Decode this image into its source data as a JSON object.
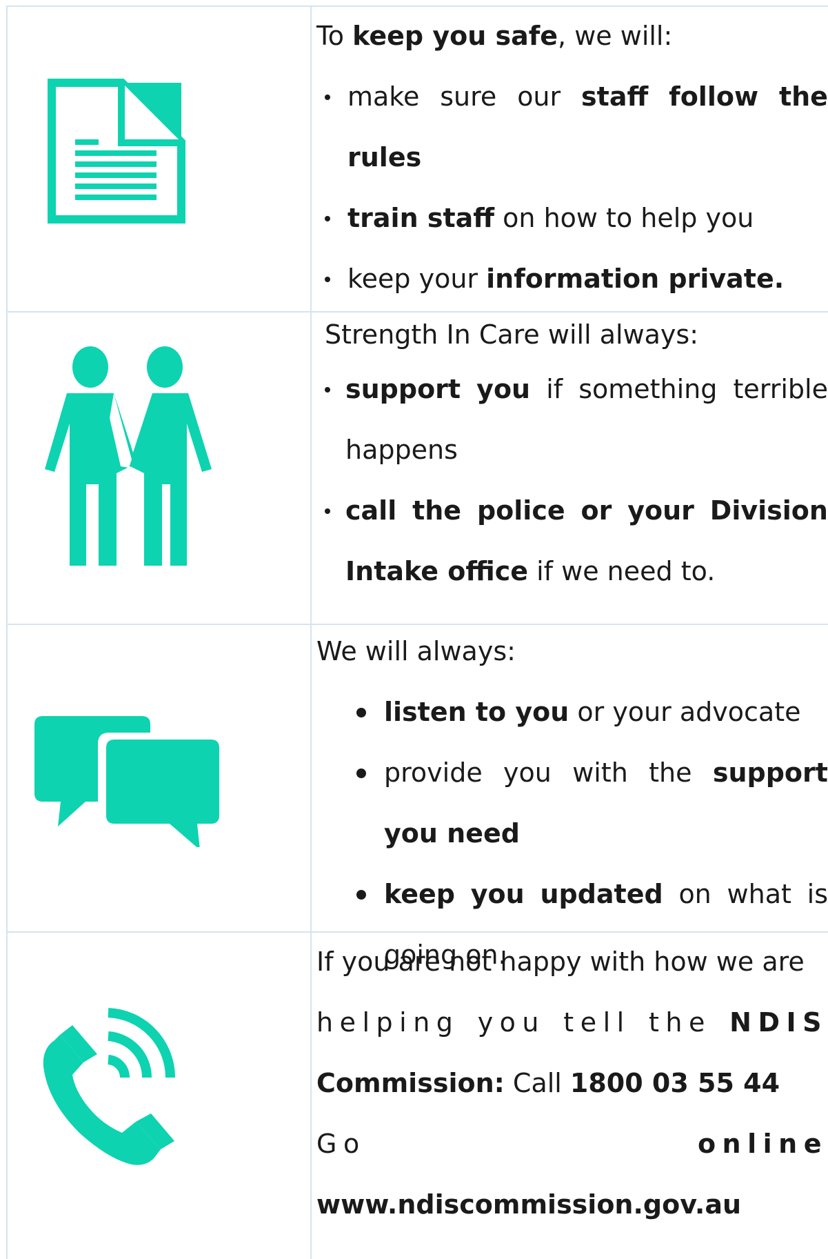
{
  "colors": {
    "accent": "#0dd3b0",
    "border": "#d6e4ef",
    "text": "#1a1a1a"
  },
  "rows": [
    {
      "icon": "document-icon",
      "intro": {
        "a": "To ",
        "b": "keep you safe",
        "c": ", we will:"
      },
      "bullets": [
        {
          "l1": [
            "make",
            "sure",
            "our"
          ],
          "l1b": [
            "staff",
            "follow",
            "the"
          ],
          "l2b": "rules"
        },
        {
          "b": "train staff",
          "t": " on how to help you"
        },
        {
          "t": "keep your ",
          "b": "information private."
        }
      ]
    },
    {
      "icon": "two-people-icon",
      "intro": "Strength In Care will always:",
      "bullets": [
        {
          "l1b": [
            "support",
            "you"
          ],
          "l1": [
            "if",
            "something",
            "terrible"
          ],
          "l2": "happens"
        },
        {
          "l1b": [
            "call",
            "the",
            "police",
            "or",
            "your",
            "Division"
          ],
          "l2b": "Intake office",
          "l2": " if we need to."
        }
      ]
    },
    {
      "icon": "speech-bubbles-icon",
      "intro": "We will always:",
      "bullets": [
        {
          "b": "listen to you",
          "t": " or your advocate"
        },
        {
          "l1": [
            "provide",
            "you",
            "with",
            "the"
          ],
          "l1b": [
            "support"
          ],
          "l2b": "you need"
        },
        {
          "l1b": [
            "keep",
            "you",
            "updated"
          ],
          "l1": [
            "on",
            "what",
            "is"
          ],
          "l2": "going on."
        }
      ]
    },
    {
      "icon": "phone-call-icon",
      "line1": "If you are not happy with how we are",
      "line2": [
        "helping",
        "you",
        "tell",
        "the"
      ],
      "line2b": "NDIS",
      "line3b": "Commission:",
      "line3": " Call ",
      "line3phone": "1800 03 55 44",
      "line4a": "Go",
      "line4b": "online",
      "line5b": "www.ndiscommission.gov.au"
    }
  ]
}
